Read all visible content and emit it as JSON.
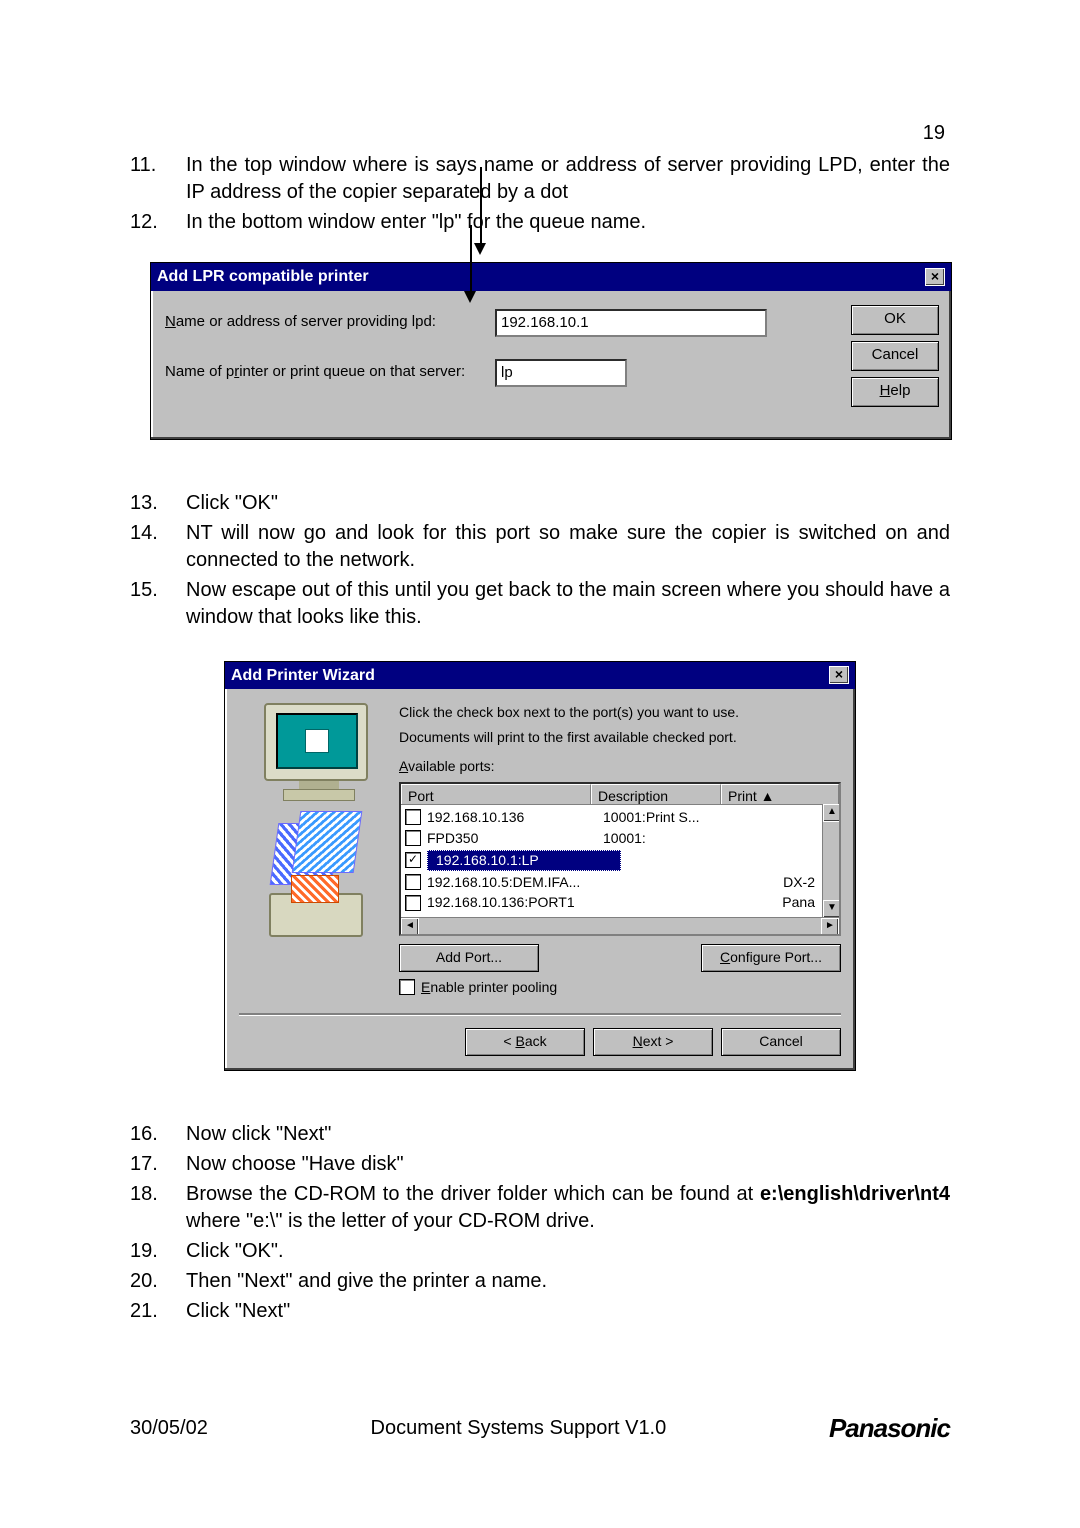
{
  "page_number": "19",
  "steps_a": [
    {
      "n": "11.",
      "t": "In the top window where is says name or address of server providing LPD, enter the IP address of the copier separated by a dot"
    },
    {
      "n": "12.",
      "t": "In the bottom window enter \"lp\" for the queue name."
    }
  ],
  "dlg1": {
    "title": "Add LPR compatible printer",
    "label1": "Name or address of server providing lpd:",
    "value1": "192.168.10.1",
    "label2": "Name of printer or print queue on that server:",
    "value2": "lp",
    "ok": "OK",
    "cancel": "Cancel",
    "help": "Help"
  },
  "steps_b": [
    {
      "n": "13.",
      "t": "Click \"OK\""
    },
    {
      "n": "14.",
      "t": "NT will now go and look for this port so make sure the copier is switched on and connected to the network."
    },
    {
      "n": "15.",
      "t": "Now escape out of this until you get back to the main screen where you should have a window that looks like this."
    }
  ],
  "dlg2": {
    "title": "Add Printer Wizard",
    "intro1": "Click the check box next to the port(s) you want to use.",
    "intro2": "Documents will print to the first available checked port.",
    "available": "Available ports:",
    "headers": {
      "port": "Port",
      "desc": "Description",
      "prn": "Print"
    },
    "rows": [
      {
        "checked": false,
        "port": "192.168.10.136",
        "desc": "10001:Print S...",
        "prn": ""
      },
      {
        "checked": false,
        "port": "FPD350",
        "desc": "10001:",
        "prn": ""
      },
      {
        "checked": true,
        "port": "192.168.10.1:LP",
        "desc": "",
        "prn": "",
        "sel": true
      },
      {
        "checked": false,
        "port": "192.168.10.5:DEM.IFA...",
        "desc": "",
        "prn": "DX-2"
      },
      {
        "checked": false,
        "port": "192.168.10.136:PORT1",
        "desc": "",
        "prn": "Pana"
      }
    ],
    "addport": "Add Port...",
    "cfgport": "Configure Port...",
    "pool": "Enable printer pooling",
    "back": "< Back",
    "next": "Next >",
    "cancel": "Cancel"
  },
  "steps_c": [
    {
      "n": "16.",
      "t": "Now click \"Next\""
    },
    {
      "n": "17.",
      "t": "Now choose \"Have disk\""
    },
    {
      "n": "18.",
      "t_pre": "Browse the CD-ROM to the driver folder which can be found at ",
      "bold": "e:\\english\\driver\\nt4",
      "t_post": "  where \"e:\\\" is the letter of your CD-ROM drive."
    },
    {
      "n": "19.",
      "t": "Click \"OK\"."
    },
    {
      "n": "20.",
      "t": "Then \"Next\" and give the printer a name."
    },
    {
      "n": "21.",
      "t": "Click \"Next\""
    }
  ],
  "footer": {
    "date": "30/05/02",
    "doc": "Document Systems Support V1.0",
    "brand": "Panasonic"
  }
}
